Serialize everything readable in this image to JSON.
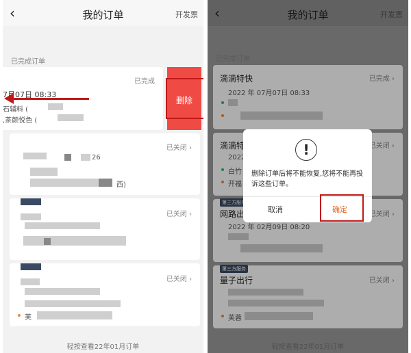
{
  "left": {
    "nav": {
      "back": "‹",
      "title": "我的订单",
      "invoice": "开发票"
    },
    "section_label": "已完成订单",
    "swiped_card": {
      "status": "已完成",
      "time": "7月07日 08:33",
      "from": "石辅料 (",
      "to": ",茶颜悦色 (",
      "delete_label": "删除"
    },
    "closed_cards": [
      {
        "status": "已关闭 ›",
        "frag": "26",
        "frag2": "西)"
      },
      {
        "status": "已关闭 ›"
      },
      {
        "status": "已关闭 ›",
        "to": "芙"
      }
    ],
    "footer": "轻按查看22年01月订单"
  },
  "right": {
    "nav": {
      "back": "‹",
      "title": "我的订单",
      "invoice": "开发票"
    },
    "section_label": "已完成订单",
    "cards": [
      {
        "name": "滴滴特快",
        "status": "已完成 ›",
        "time": "2022 年 07月07日 08:33"
      },
      {
        "name": "滴滴特",
        "status": "已关闭 ›",
        "time": "2022",
        "from": "白竹",
        "to": "开福"
      },
      {
        "tag": "第三方服务",
        "name": "网路出行",
        "status": "已关闭 ›",
        "time": "2022 年 02月09日 08:20"
      },
      {
        "tag": "第三方服务",
        "name": "量子出行",
        "status": "已关闭 ›",
        "to": "芙蓉"
      }
    ],
    "footer": "轻按查看22年01月订单",
    "dialog": {
      "icon": "!",
      "message": "删除订单后将不能恢复,您将不能再投诉这些订单。",
      "cancel": "取消",
      "confirm": "确定"
    }
  }
}
